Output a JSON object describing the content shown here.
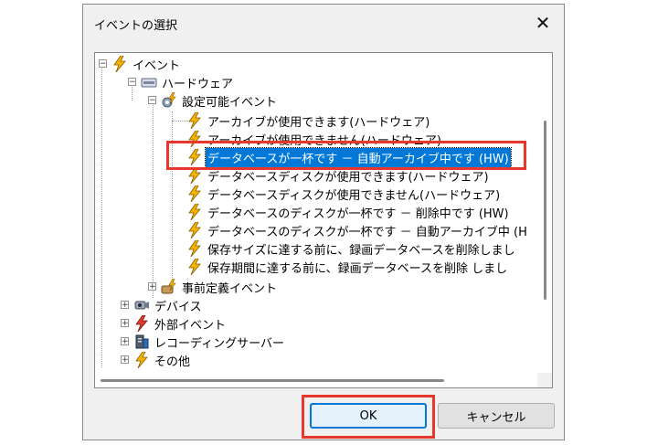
{
  "dialog": {
    "title": "イベントの選択",
    "close_glyph": "✕"
  },
  "tree": {
    "root": {
      "label": "イベント",
      "expanded": true
    },
    "hardware": {
      "label": "ハードウェア",
      "expanded": true
    },
    "configurable": {
      "label": "設定可能イベント",
      "expanded": true
    },
    "events": [
      "アーカイブが使用できます(ハードウェア)",
      "アーカイブが使用できません(ハードウェア)",
      "データベースが一杯です － 自動アーカイブ中です (HW)",
      "データベースディスクが使用できます(ハードウェア)",
      "データベースディスクが使用できません(ハードウェア)",
      "データベースのディスクが一杯です － 削除中です (HW)",
      "データベースのディスクが一杯です － 自動アーカイブ中 (H",
      "保存サイズに達する前に、録画データベースを削除しまし",
      "保存期間に達する前に、録画データベースを削除 しまし"
    ],
    "selected_index": 2,
    "predefined": {
      "label": "事前定義イベント"
    },
    "top_groups": [
      "デバイス",
      "外部イベント",
      "レコーディングサーバー",
      "その他"
    ]
  },
  "buttons": {
    "ok": "OK",
    "cancel": "キャンセル"
  },
  "colors": {
    "highlight": "#0078d7",
    "annotation": "#e8372c",
    "lightning": "#f4b400"
  }
}
